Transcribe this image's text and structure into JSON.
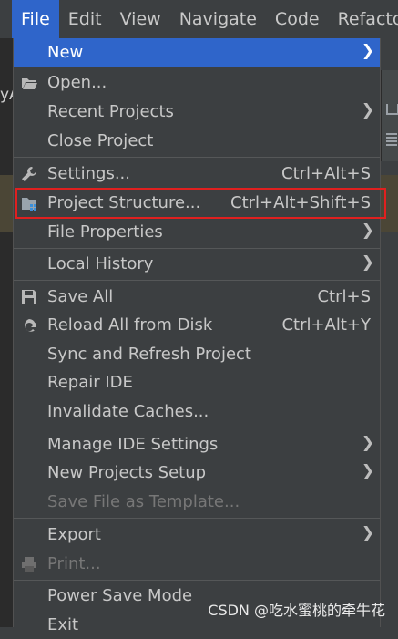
{
  "menubar": {
    "items": [
      "File",
      "Edit",
      "View",
      "Navigate",
      "Code",
      "Refactor"
    ]
  },
  "background": {
    "left_fragment": "yA"
  },
  "menu": {
    "new": "New",
    "open": "Open...",
    "recent_projects": "Recent Projects",
    "close_project": "Close Project",
    "settings": "Settings...",
    "settings_shortcut": "Ctrl+Alt+S",
    "project_structure": "Project Structure...",
    "project_structure_shortcut": "Ctrl+Alt+Shift+S",
    "file_properties": "File Properties",
    "local_history": "Local History",
    "save_all": "Save All",
    "save_all_shortcut": "Ctrl+S",
    "reload_all": "Reload All from Disk",
    "reload_all_shortcut": "Ctrl+Alt+Y",
    "sync_refresh": "Sync and Refresh Project",
    "repair_ide": "Repair IDE",
    "invalidate_caches": "Invalidate Caches...",
    "manage_ide_settings": "Manage IDE Settings",
    "new_projects_setup": "New Projects Setup",
    "save_as_template": "Save File as Template...",
    "export": "Export",
    "print": "Print...",
    "power_save": "Power Save Mode",
    "exit": "Exit"
  },
  "watermark": "CSDN @吃水蜜桃的牵牛花",
  "colors": {
    "menu_bg": "#3c3f41",
    "selection": "#2f65ca",
    "highlight_border": "#e0201f"
  }
}
